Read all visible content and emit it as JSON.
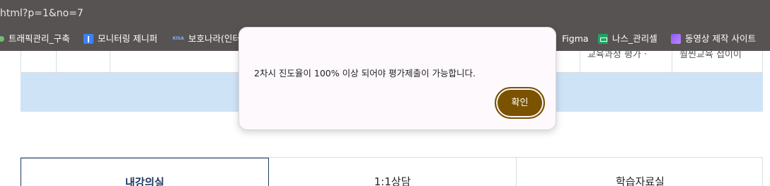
{
  "browser": {
    "url_fragment": "html?p=1&no=7",
    "bookmarks": [
      {
        "label": "트래픽관리_구축",
        "icon": "green-dot-icon"
      },
      {
        "label": "모니터링 제니퍼",
        "icon": "blue-pin-icon"
      },
      {
        "label": "보호나라(인터",
        "icon": "kisa-icon"
      },
      {
        "label": "Figma",
        "icon": "none"
      },
      {
        "label": "나스_관리셀",
        "icon": "sheets-icon"
      },
      {
        "label": "동영상 제작 사이트",
        "icon": "folder-video-icon"
      }
    ]
  },
  "table": {
    "partial_cells": [
      "교육과정 평가 ·",
      "훨씬교육 접이이"
    ]
  },
  "tabs": [
    {
      "label": "내강의실",
      "active": true
    },
    {
      "label": "1:1상담",
      "active": false
    },
    {
      "label": "학습자료실",
      "active": false
    }
  ],
  "dialog": {
    "message": "2차시 진도율이 100% 이상 되어야 평가제출이 가능합니다.",
    "confirm_label": "확인"
  },
  "colors": {
    "chrome_bg": "#575352",
    "band": "#cfe3f6",
    "confirm_button": "#7a5200",
    "active_tab": "#1f3a63"
  }
}
